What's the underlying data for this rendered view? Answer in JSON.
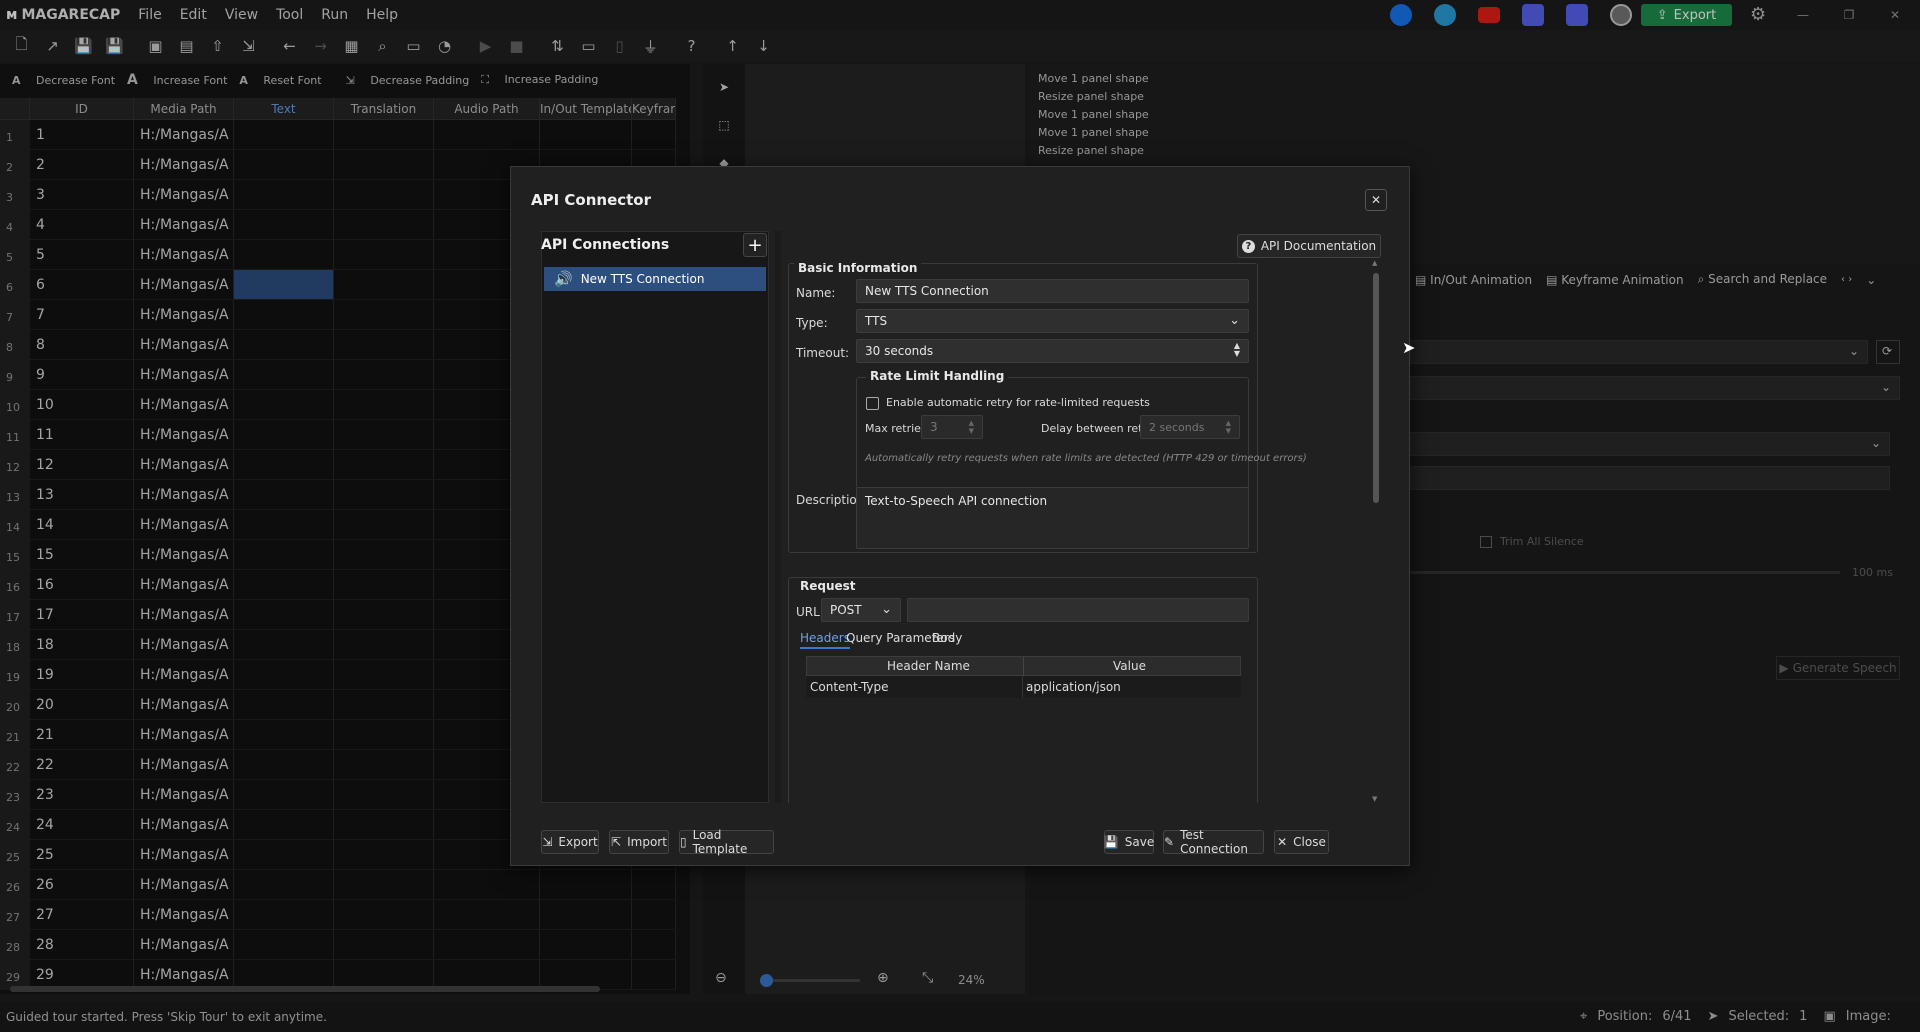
{
  "app": {
    "name": "MAGARECAP",
    "menus": [
      "File",
      "Edit",
      "View",
      "Tool",
      "Run",
      "Help"
    ],
    "export_label": "Export"
  },
  "fontbar": {
    "decrease_font": "Decrease Font",
    "increase_font": "Increase Font",
    "reset_font": "Reset Font",
    "decrease_padding": "Decrease Padding",
    "increase_padding": "Increase Padding"
  },
  "table": {
    "headers": [
      "ID",
      "Media Path",
      "Text",
      "Translation",
      "Audio Path",
      "In/Out Template",
      "Keyfram"
    ],
    "media_path": "H:/Mangas/A",
    "rows": [
      "1",
      "2",
      "3",
      "4",
      "5",
      "6",
      "7",
      "8",
      "9",
      "10",
      "11",
      "12",
      "13",
      "14",
      "15",
      "16",
      "17",
      "18",
      "19",
      "20",
      "21",
      "22",
      "23",
      "24",
      "25",
      "26",
      "27",
      "28",
      "29"
    ]
  },
  "undo_history": [
    "Move 1 panel shape",
    "Resize panel shape",
    "Move 1 panel shape",
    "Move 1 panel shape",
    "Resize panel shape"
  ],
  "right_tabs": [
    "In/Out Animation",
    "Keyframe Animation",
    "Search and Replace"
  ],
  "right_panel": {
    "trim_label": "Trim All Silence",
    "ms_label": "100 ms",
    "generate_label": "Generate Speech"
  },
  "zoom": {
    "value": "24%"
  },
  "status": {
    "message": "Guided tour started. Press 'Skip Tour' to exit anytime.",
    "position_label": "Position:",
    "position_value": "6/41",
    "selected_label": "Selected:",
    "selected_value": "1",
    "image_label": "Image:"
  },
  "dialog": {
    "title": "API Connector",
    "connections_title": "API Connections",
    "connections": [
      "New TTS Connection"
    ],
    "api_doc": "API Documentation",
    "basic_info": "Basic Information",
    "name_label": "Name:",
    "name_value": "New TTS Connection",
    "type_label": "Type:",
    "type_value": "TTS",
    "timeout_label": "Timeout:",
    "timeout_value": "30 seconds",
    "rate_title": "Rate Limit Handling",
    "retry_label": "Enable automatic retry for rate-limited requests",
    "max_retries_label": "Max retries:",
    "max_retries_value": "3",
    "delay_label": "Delay between retries:",
    "delay_value": "2 seconds",
    "rate_note": "Automatically retry requests when rate limits are detected (HTTP 429 or timeout errors)",
    "desc_label": "Description:",
    "desc_value": "Text-to-Speech API connection",
    "request_title": "Request",
    "url_label": "URL:",
    "method": "POST",
    "url_value": "",
    "tabs": [
      "Headers",
      "Query Parameters",
      "Body"
    ],
    "header_cols": [
      "Header Name",
      "Value"
    ],
    "header_rows": [
      [
        "Content-Type",
        "application/json"
      ]
    ],
    "buttons": {
      "export": "Export",
      "import": "Import",
      "load_template": "Load Template",
      "save": "Save",
      "test": "Test Connection",
      "close": "Close"
    }
  }
}
